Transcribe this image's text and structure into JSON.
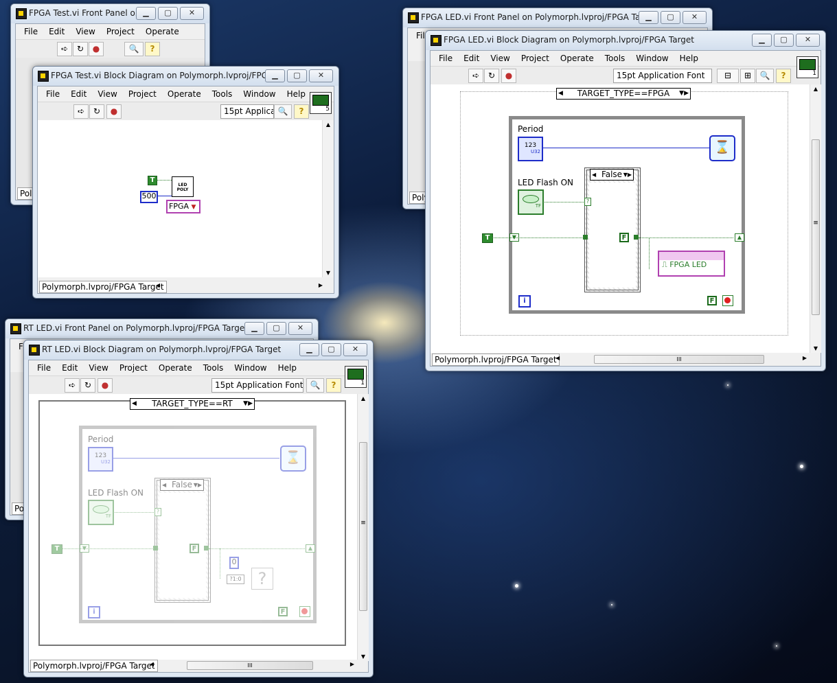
{
  "windows": {
    "fpga_test_front": {
      "title": "FPGA Test.vi Front Panel o...",
      "menu": [
        "File",
        "Edit",
        "View",
        "Project",
        "Operate"
      ],
      "status": "Poly"
    },
    "fpga_test_block": {
      "title": "FPGA Test.vi Block Diagram on Polymorph.lvproj/FPGA ...",
      "menu": [
        "File",
        "Edit",
        "View",
        "Project",
        "Operate",
        "Tools",
        "Window",
        "Help"
      ],
      "font": "15pt Applicat",
      "icon_num": "5",
      "status": "Polymorph.lvproj/FPGA Target",
      "diagram": {
        "true_const": "T",
        "num_const": "500",
        "subvi_line1": "LED",
        "subvi_line2": "POLY",
        "selector": "FPGA"
      }
    },
    "fpga_led_front": {
      "title": "FPGA LED.vi Front Panel on Polymorph.lvproj/FPGA Target",
      "menu": [
        "File"
      ],
      "status": "Poly"
    },
    "fpga_led_block": {
      "title": "FPGA LED.vi Block Diagram on Polymorph.lvproj/FPGA Target",
      "menu": [
        "File",
        "Edit",
        "View",
        "Project",
        "Operate",
        "Tools",
        "Window",
        "Help"
      ],
      "font": "15pt Application Font",
      "icon_num": "1",
      "status": "Polymorph.lvproj/FPGA Target",
      "diagram": {
        "case_label": "TARGET_TYPE==FPGA",
        "period_label": "Period",
        "period_term": "123",
        "period_type": "U32",
        "led_label": "LED Flash ON",
        "led_type": "TF",
        "inner_case": "False",
        "true_const": "T",
        "false_const": "F",
        "stop_const": "F",
        "iter": "i",
        "io_node": "FPGA LED",
        "question": "?"
      }
    },
    "rt_led_front": {
      "title": "RT LED.vi Front Panel on Polymorph.lvproj/FPGA Target",
      "menu": [
        "Fi"
      ],
      "status": "Po"
    },
    "rt_led_block": {
      "title": "RT LED.vi Block Diagram on Polymorph.lvproj/FPGA Target",
      "menu": [
        "File",
        "Edit",
        "View",
        "Project",
        "Operate",
        "Tools",
        "Window",
        "Help"
      ],
      "font": "15pt Application Font",
      "icon_num": "1",
      "status": "Polymorph.lvproj/FPGA Target",
      "diagram": {
        "case_label": "TARGET_TYPE==RT",
        "period_label": "Period",
        "period_term": "123",
        "period_type": "U32",
        "led_label": "LED Flash ON",
        "led_type": "TF",
        "inner_case": "False",
        "true_const": "T",
        "false_const": "F",
        "stop_const": "F",
        "iter": "i",
        "zero_const": "0",
        "select_label": "?1:0",
        "question": "?"
      }
    }
  },
  "scroll_grip": "≡",
  "hscroll_grip": "III",
  "icons": [
    "run-arrow-icon",
    "run-continuous-icon",
    "abort-icon",
    "search-icon",
    "help-icon",
    "wait-timer-icon",
    "stop-terminal-icon"
  ],
  "colors": {
    "numeric_wire": "#1d2cc9",
    "boolean_wire": "#2b7d2b",
    "io_node": "#b040b0",
    "loop_border": "#8a8a8a"
  }
}
